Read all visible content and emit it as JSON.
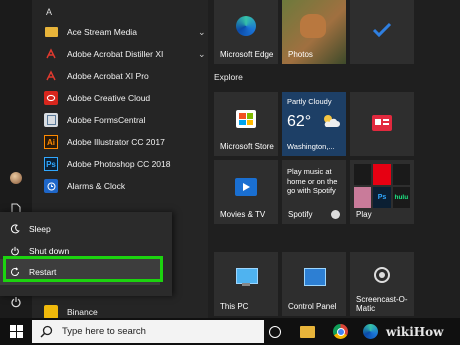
{
  "start_menu": {
    "section_letter": "A",
    "apps": [
      {
        "label": "Ace Stream Media",
        "icon": "folder-icon",
        "expandable": true
      },
      {
        "label": "Adobe Acrobat Distiller XI",
        "icon": "acrobat-distiller-icon",
        "expandable": true
      },
      {
        "label": "Adobe Acrobat XI Pro",
        "icon": "acrobat-icon",
        "expandable": false
      },
      {
        "label": "Adobe Creative Cloud",
        "icon": "creative-cloud-icon",
        "expandable": false
      },
      {
        "label": "Adobe FormsCentral",
        "icon": "forms-central-icon",
        "expandable": false
      },
      {
        "label": "Adobe Illustrator CC 2017",
        "icon": "illustrator-icon",
        "expandable": false
      },
      {
        "label": "Adobe Photoshop CC 2018",
        "icon": "photoshop-icon",
        "expandable": false
      },
      {
        "label": "Alarms & Clock",
        "icon": "alarm-clock-icon",
        "expandable": false
      }
    ],
    "illustrator_badge": "Ai",
    "photoshop_badge": "Ps",
    "partial_item": "Binance"
  },
  "power_menu": {
    "sleep": "Sleep",
    "shutdown": "Shut down",
    "restart": "Restart",
    "highlight_color": "#1cd30f"
  },
  "tiles": {
    "edge": "Microsoft Edge",
    "photos": "Photos",
    "explore_heading": "Explore",
    "store": "Microsoft Store",
    "weather": {
      "condition": "Partly Cloudy",
      "temp": "62°",
      "location": "Washington,..."
    },
    "movies": "Movies & TV",
    "spotify": {
      "label": "Spotify",
      "text": "Play music at home or on the go with Spotify"
    },
    "play": "Play",
    "this_pc": "This PC",
    "control_panel": "Control Panel",
    "screencast": "Screencast-O-Matic",
    "play_badges": {
      "ps": "Ps",
      "hulu": "hulu"
    }
  },
  "taskbar": {
    "search_placeholder": "Type here to search"
  },
  "watermark": "wikiHow"
}
